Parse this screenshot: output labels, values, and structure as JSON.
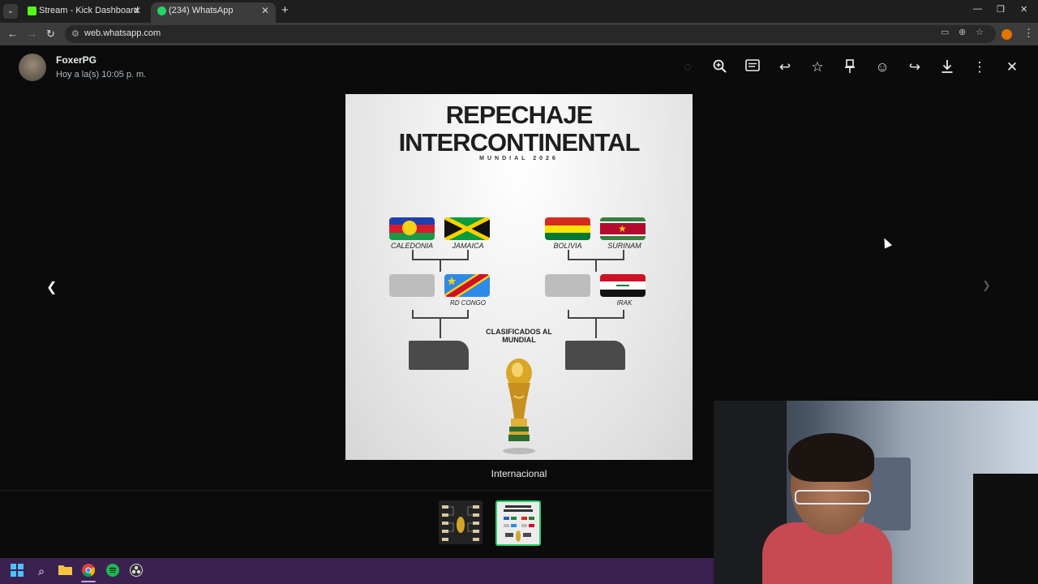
{
  "browser": {
    "tabs": [
      {
        "label": "Stream - Kick Dashboard",
        "favicon_color": "#53fc18"
      },
      {
        "label": "(234) WhatsApp",
        "favicon_color": "#25d366"
      }
    ],
    "url": "web.whatsapp.com"
  },
  "viewer": {
    "sender": "FoxerPG",
    "timestamp": "Hoy a la(s) 10:05 p. m.",
    "caption": "Internacional",
    "toolbar_icons": [
      "zoom-in-icon",
      "message-icon",
      "reply-icon",
      "star-icon",
      "pin-icon",
      "react-icon",
      "forward-icon",
      "download-icon",
      "more-icon",
      "close-icon"
    ]
  },
  "poster": {
    "title_line1": "REPECHAJE",
    "title_line2": "INTERCONTINENTAL",
    "subtitle": "MUNDIAL 2026",
    "clasificados": "CLASIFICADOS AL MUNDIAL",
    "countries": {
      "caledonia": "CALEDONIA",
      "jamaica": "JAMAICA",
      "rdcongo": "RD CONGO",
      "bolivia": "BOLIVIA",
      "surinam": "SURINAM",
      "irak": "IRAK"
    }
  },
  "taskbar": {
    "icons": [
      "windows-icon",
      "search-icon",
      "file-explorer-icon",
      "chrome-icon",
      "spotify-icon",
      "obs-icon"
    ]
  }
}
